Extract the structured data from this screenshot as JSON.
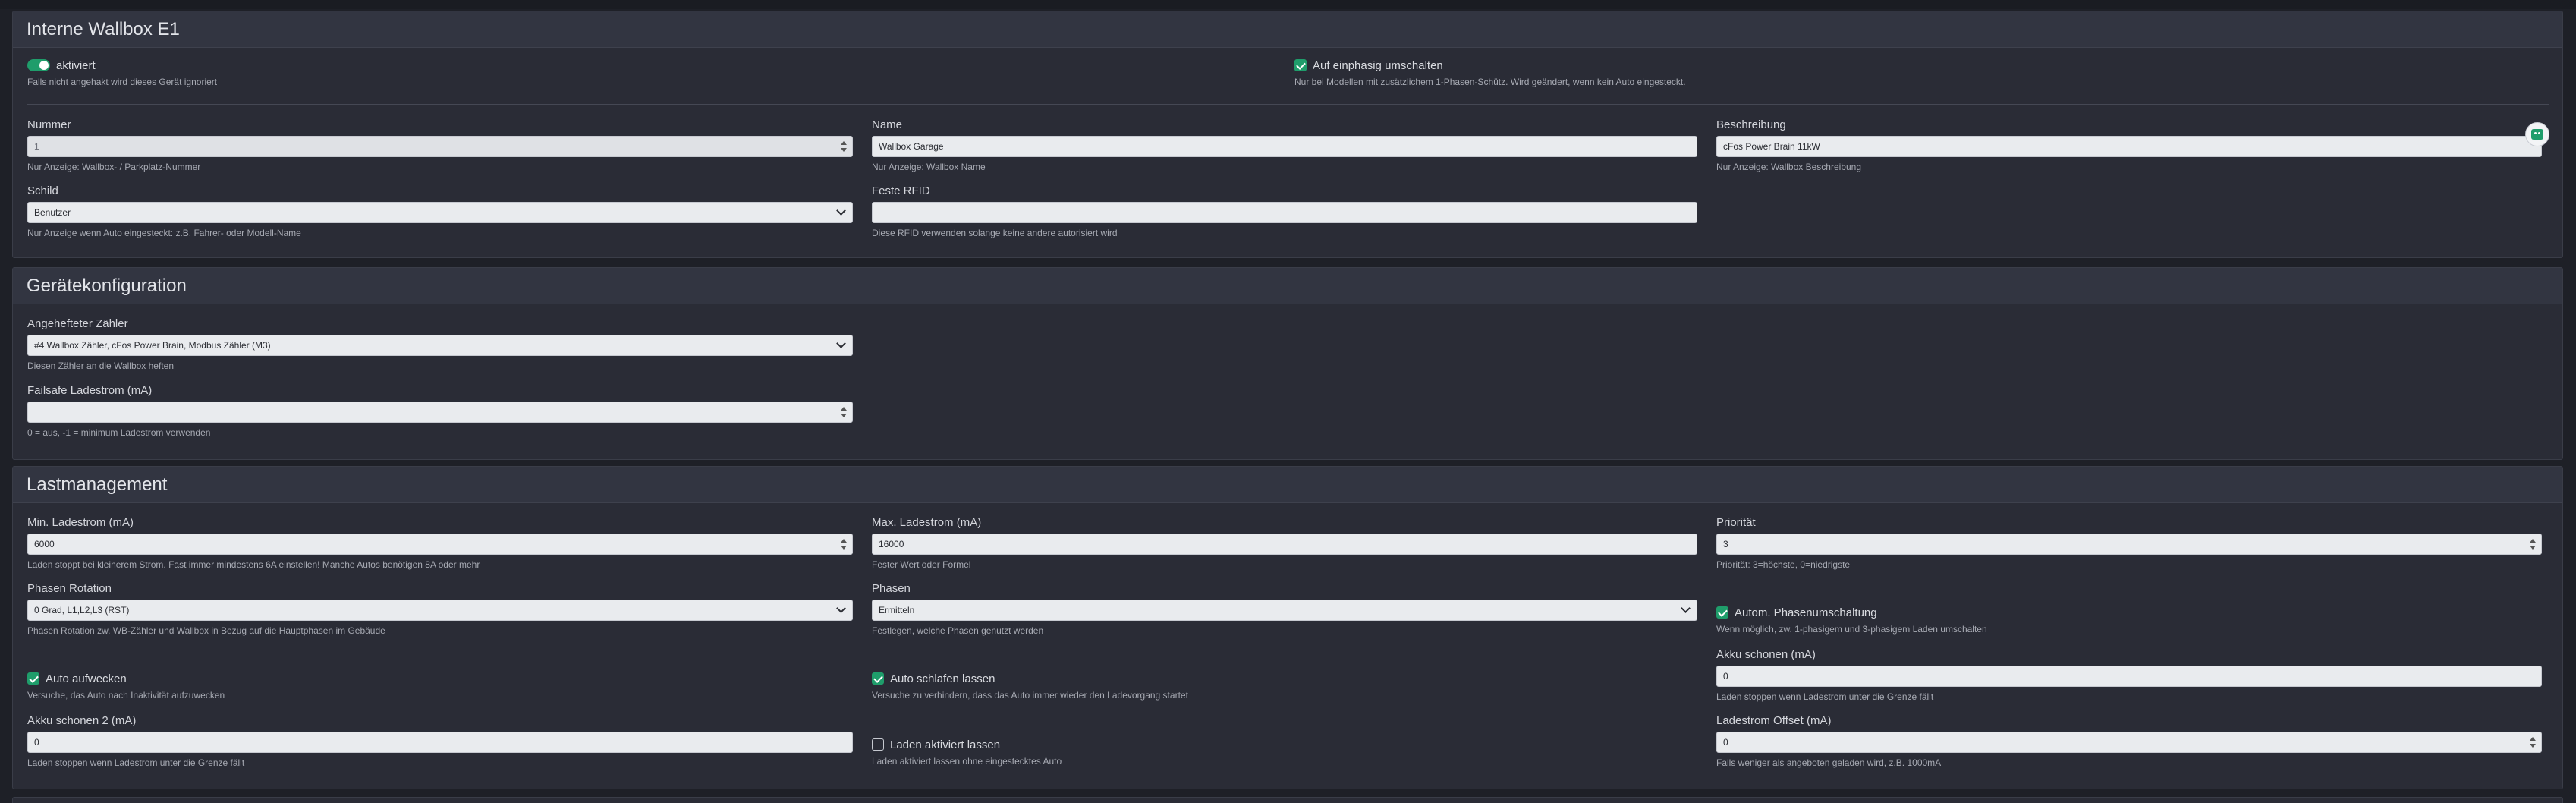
{
  "section1": {
    "title": "Interne Wallbox E1",
    "aktiviert": {
      "label": "aktiviert",
      "hint": "Falls nicht angehakt wird dieses Gerät ignoriert"
    },
    "einphasig": {
      "label": "Auf einphasig umschalten",
      "hint": "Nur bei Modellen mit zusätzlichem 1-Phasen-Schütz. Wird geändert, wenn kein Auto eingesteckt."
    },
    "nummer": {
      "label": "Nummer",
      "value": "1",
      "hint": "Nur Anzeige: Wallbox- / Parkplatz-Nummer"
    },
    "name": {
      "label": "Name",
      "value": "Wallbox Garage",
      "hint": "Nur Anzeige: Wallbox Name"
    },
    "beschreibung": {
      "label": "Beschreibung",
      "value": "cFos Power Brain 11kW",
      "hint": "Nur Anzeige: Wallbox Beschreibung"
    },
    "schild": {
      "label": "Schild",
      "value": "Benutzer",
      "hint": "Nur Anzeige wenn Auto eingesteckt: z.B. Fahrer- oder Modell-Name"
    },
    "rfid": {
      "label": "Feste RFID",
      "value": "",
      "hint": "Diese RFID verwenden solange keine andere autorisiert wird"
    }
  },
  "section2": {
    "title": "Gerätekonfiguration",
    "zaehler": {
      "label": "Angehefteter Zähler",
      "value": "#4 Wallbox Zähler, cFos Power Brain, Modbus Zähler (M3)",
      "hint": "Diesen Zähler an die Wallbox heften"
    },
    "failsafe": {
      "label": "Failsafe Ladestrom (mA)",
      "value": "",
      "hint": "0 = aus, -1 = minimum Ladestrom verwenden"
    }
  },
  "section3": {
    "title": "Lastmanagement",
    "min": {
      "label": "Min. Ladestrom (mA)",
      "value": "6000",
      "hint": "Laden stoppt bei kleinerem Strom. Fast immer mindestens 6A einstellen! Manche Autos benötigen 8A oder mehr"
    },
    "max": {
      "label": "Max. Ladestrom (mA)",
      "value": "16000",
      "hint": "Fester Wert oder Formel"
    },
    "prio": {
      "label": "Priorität",
      "value": "3",
      "hint": "Priorität: 3=höchste, 0=niedrigste"
    },
    "rotation": {
      "label": "Phasen Rotation",
      "value": "0 Grad, L1,L2,L3 (RST)",
      "hint": "Phasen Rotation zw. WB-Zähler und Wallbox in Bezug auf die Hauptphasen im Gebäude"
    },
    "phasen": {
      "label": "Phasen",
      "value": "Ermitteln",
      "hint": "Festlegen, welche Phasen genutzt werden"
    },
    "autoPhasen": {
      "label": "Autom. Phasenumschaltung",
      "hint": "Wenn möglich, zw. 1-phasigem und 3-phasigem Laden umschalten"
    },
    "aufwecken": {
      "label": "Auto aufwecken",
      "hint": "Versuche, das Auto nach Inaktivität aufzuwecken"
    },
    "schlafen": {
      "label": "Auto schlafen lassen",
      "hint": "Versuche zu verhindern, dass das Auto immer wieder den Ladevorgang startet"
    },
    "akku": {
      "label": "Akku schonen (mA)",
      "value": "0",
      "hint": "Laden stoppen wenn Ladestrom unter die Grenze fällt"
    },
    "akku2": {
      "label": "Akku schonen 2 (mA)",
      "value": "0",
      "hint": "Laden stoppen wenn Ladestrom unter die Grenze fällt"
    },
    "ladenAktiv": {
      "label": "Laden aktiviert lassen",
      "hint": "Laden aktiviert lassen ohne eingestecktes Auto"
    },
    "offset": {
      "label": "Ladestrom Offset (mA)",
      "value": "0",
      "hint": "Falls weniger als angeboten geladen wird, z.B. 1000mA"
    }
  },
  "colors": {
    "accent": "#1f9d6b",
    "panel": "#2a2c36",
    "header": "#323541",
    "background": "#1e2027"
  },
  "icons": {
    "help": "chat-bot-icon"
  }
}
